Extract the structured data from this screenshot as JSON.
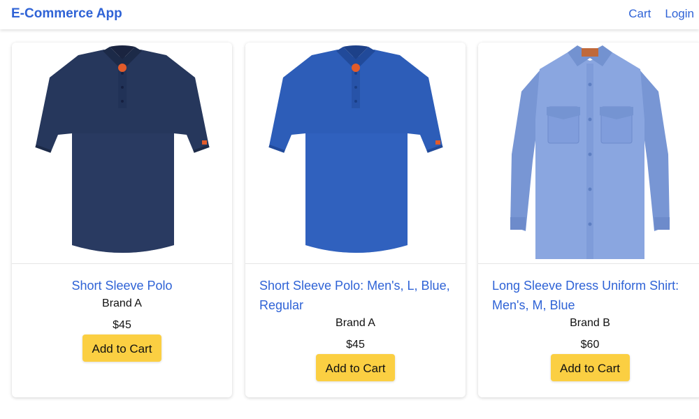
{
  "navbar": {
    "brand": "E-Commerce App",
    "links": [
      "Cart",
      "Login"
    ]
  },
  "products": [
    {
      "title": "Short Sleeve Polo",
      "brand": "Brand A",
      "price": "$45",
      "button": "Add to Cart",
      "image": "navy-short-sleeve-polo",
      "color": "#263c66"
    },
    {
      "title": "Short Sleeve Polo: Men's, L, Blue, Regular",
      "brand": "Brand A",
      "price": "$45",
      "button": "Add to Cart",
      "image": "royal-blue-short-sleeve-polo",
      "color": "#2f5fba"
    },
    {
      "title": "Long Sleeve Dress Uniform Shirt: Men's, M, Blue",
      "brand": "Brand B",
      "price": "$60",
      "button": "Add to Cart",
      "image": "light-blue-long-sleeve-shirt",
      "color": "#7f9fdc"
    }
  ],
  "colors": {
    "accent": "#2f63d6",
    "button": "#fbcf42"
  }
}
